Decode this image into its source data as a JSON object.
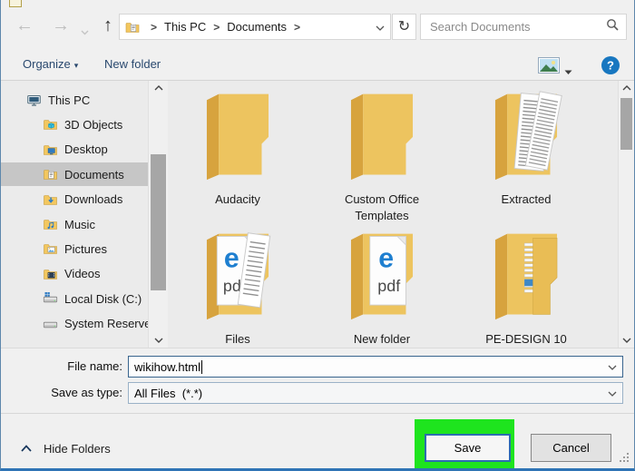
{
  "toolbar": {
    "breadcrumb": [
      "This PC",
      "Documents"
    ],
    "crumb_separator": ">",
    "search_placeholder": "Search Documents",
    "icons": [
      "back-arrow",
      "forward-arrow",
      "history-chevron",
      "up-arrow",
      "documents-folder",
      "breadcrumb-chevron",
      "refresh",
      "magnifier"
    ]
  },
  "commandbar": {
    "organize_label": "Organize",
    "new_folder_label": "New folder",
    "icons": [
      "caret-down",
      "thumbnail-view",
      "view-caret-down",
      "help-question"
    ]
  },
  "sidebar": {
    "items": [
      {
        "label": "This PC",
        "icon": "pc",
        "level": 0,
        "selected": false
      },
      {
        "label": "3D Objects",
        "icon": "objects3d",
        "level": 1,
        "selected": false
      },
      {
        "label": "Desktop",
        "icon": "desktop",
        "level": 1,
        "selected": false
      },
      {
        "label": "Documents",
        "icon": "documents",
        "level": 1,
        "selected": true
      },
      {
        "label": "Downloads",
        "icon": "downloads",
        "level": 1,
        "selected": false
      },
      {
        "label": "Music",
        "icon": "music",
        "level": 1,
        "selected": false
      },
      {
        "label": "Pictures",
        "icon": "pictures",
        "level": 1,
        "selected": false
      },
      {
        "label": "Videos",
        "icon": "videos",
        "level": 1,
        "selected": false
      },
      {
        "label": "Local Disk (C:)",
        "icon": "diskwin",
        "level": 1,
        "selected": false
      },
      {
        "label": "System Reserved",
        "icon": "disk",
        "level": 1,
        "selected": false
      }
    ]
  },
  "files": {
    "items": [
      {
        "name": "Audacity",
        "type": "folder-empty"
      },
      {
        "name": "Custom Office Templates",
        "type": "folder-empty"
      },
      {
        "name": "Extracted",
        "type": "folder-docs"
      },
      {
        "name": "Files",
        "type": "folder-pdf-stack"
      },
      {
        "name": "New folder",
        "type": "folder-pdf"
      },
      {
        "name": "PE-DESIGN 10",
        "type": "folder-slats"
      }
    ]
  },
  "filename_row": {
    "label": "File name:",
    "value": "wikihow.html"
  },
  "savetype_row": {
    "label": "Save as type:",
    "value": "All Files  (*.*)"
  },
  "footer": {
    "hide_folders_label": "Hide Folders",
    "save_label": "Save",
    "cancel_label": "Cancel"
  },
  "colors": {
    "highlight_green": "#1ee41e",
    "save_border_blue": "#2b6cb0",
    "folder_yellow": "#edc45f",
    "command_text_navy": "#29486e",
    "selected_gray": "#c6c6c6",
    "window_border_blue": "#2f74b5"
  }
}
